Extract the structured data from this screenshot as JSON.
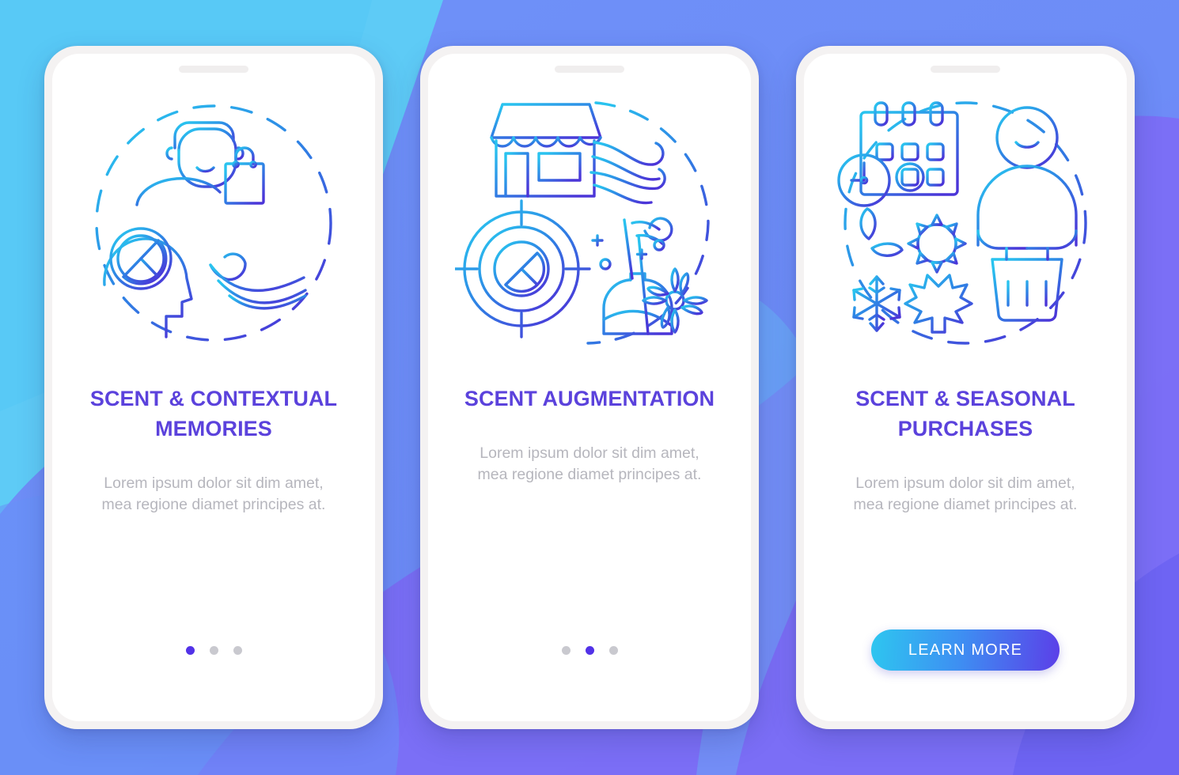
{
  "background": {
    "colors": {
      "cyan": "#5ecbf6",
      "blue_light": "#6f92f8",
      "blue_mid": "#6b8ef8",
      "purple": "#7b6ef6",
      "purple_deep": "#6a62f2"
    }
  },
  "theme": {
    "title_color": "#5b42dc",
    "desc_color": "#b6b6bd",
    "dot_active_color": "#5232e8",
    "dot_inactive_color": "#c9c9cf",
    "cta_gradient_from": "#2ec6f0",
    "cta_gradient_to": "#5b3fe8",
    "illustration_gradient_from": "#29c3ef",
    "illustration_gradient_to": "#4b35d8"
  },
  "screens": [
    {
      "id": "scent-contextual-memories",
      "title": "SCENT & CONTEXTUAL MEMORIES",
      "description": "Lorem ipsum dolor sit dim amet, mea regione diamet principes at.",
      "illustration": "person-shopping-bag-head-citrus-scent-waves",
      "footer_type": "dots",
      "dots": {
        "count": 3,
        "active_index": 0
      }
    },
    {
      "id": "scent-augmentation",
      "title": "SCENT AUGMENTATION",
      "description": "Lorem ipsum dolor sit dim amet, mea regione diamet principes at.",
      "illustration": "storefront-wind-target-citrus-reed-diffuser",
      "footer_type": "dots",
      "dots": {
        "count": 3,
        "active_index": 1
      }
    },
    {
      "id": "scent-seasonal-purchases",
      "title": "SCENT & SEASONAL PURCHASES",
      "description": "Lorem ipsum dolor sit dim amet, mea regione diamet principes at.",
      "illustration": "calendar-clock-seasons-person-basket",
      "footer_type": "button",
      "button_label": "LEARN MORE"
    }
  ]
}
